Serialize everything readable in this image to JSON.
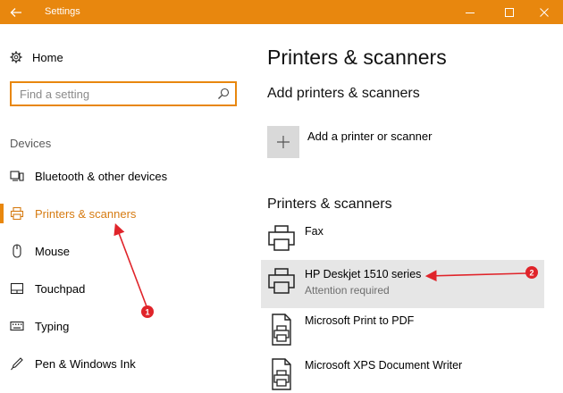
{
  "window": {
    "title": "Settings",
    "accent": "#e8870e",
    "controls": [
      "back-arrow-icon",
      "minimize-icon",
      "maximize-icon",
      "close-icon"
    ]
  },
  "sidebar": {
    "home_label": "Home",
    "search_placeholder": "Find a setting",
    "section_label": "Devices",
    "items": [
      {
        "label": "Bluetooth & other devices",
        "icon": "bluetooth-devices-icon",
        "active": false
      },
      {
        "label": "Printers & scanners",
        "icon": "printer-icon",
        "active": true
      },
      {
        "label": "Mouse",
        "icon": "mouse-icon",
        "active": false
      },
      {
        "label": "Touchpad",
        "icon": "touchpad-icon",
        "active": false
      },
      {
        "label": "Typing",
        "icon": "keyboard-icon",
        "active": false
      },
      {
        "label": "Pen & Windows Ink",
        "icon": "pen-icon",
        "active": false
      }
    ]
  },
  "main": {
    "title": "Printers & scanners",
    "add_section_title": "Add printers & scanners",
    "add_button_label": "Add a printer or scanner",
    "list_section_title": "Printers & scanners",
    "printers": [
      {
        "name": "Fax",
        "status": "",
        "icon": "printer-icon",
        "selected": false
      },
      {
        "name": "HP Deskjet 1510 series",
        "status": "Attention required",
        "icon": "printer-icon",
        "selected": true
      },
      {
        "name": "Microsoft Print to PDF",
        "status": "",
        "icon": "document-printer-icon",
        "selected": false
      },
      {
        "name": "Microsoft XPS Document Writer",
        "status": "",
        "icon": "document-printer-icon",
        "selected": false
      }
    ]
  },
  "annotations": [
    {
      "number": "1",
      "color": "#e0242a"
    },
    {
      "number": "2",
      "color": "#e0242a"
    }
  ]
}
